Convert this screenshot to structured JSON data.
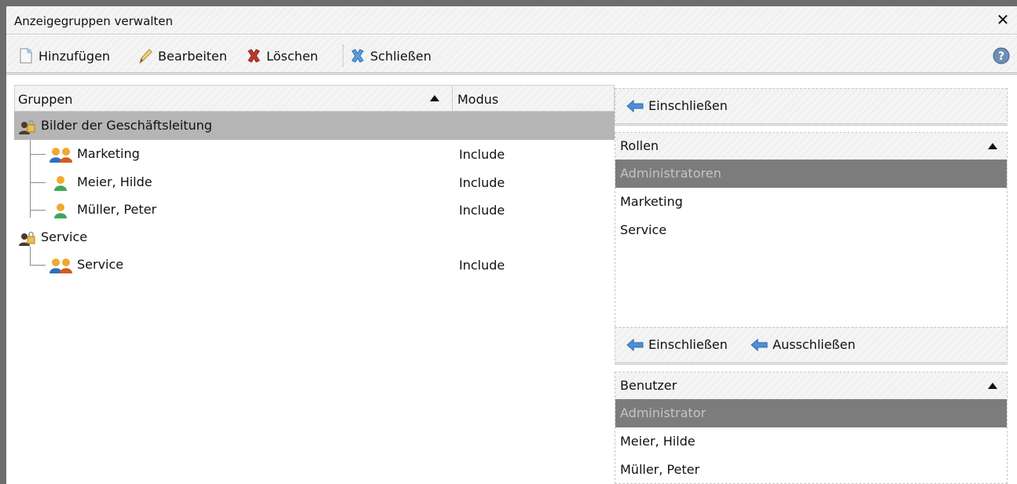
{
  "window": {
    "title": "Anzeigegruppen verwalten"
  },
  "toolbar": {
    "add_label": "Hinzufügen",
    "edit_label": "Bearbeiten",
    "delete_label": "Löschen",
    "close_label": "Schließen"
  },
  "tree": {
    "columns": {
      "groups": "Gruppen",
      "mode": "Modus"
    },
    "groups": [
      {
        "label": "Bilder der Geschäftsleitung",
        "selected": true,
        "children": [
          {
            "label": "Marketing",
            "mode": "Include",
            "type": "role"
          },
          {
            "label": "Meier, Hilde",
            "mode": "Include",
            "type": "user"
          },
          {
            "label": "Müller, Peter",
            "mode": "Include",
            "type": "user"
          }
        ]
      },
      {
        "label": "Service",
        "selected": false,
        "children": [
          {
            "label": "Service",
            "mode": "Include",
            "type": "role"
          }
        ]
      }
    ]
  },
  "roles_panel": {
    "include_label": "Einschließen",
    "header": "Rollen",
    "items": [
      "Administratoren",
      "Marketing",
      "Service"
    ],
    "selected_item": "Administratoren"
  },
  "users_panel": {
    "include_label": "Einschließen",
    "exclude_label": "Ausschließen",
    "header": "Benutzer",
    "items": [
      "Administrator",
      "Meier, Hilde",
      "Müller, Peter"
    ],
    "selected_item": "Administrator"
  },
  "colors": {
    "selected_tree_row": "#b5b5b5",
    "selected_list_row": "#7c7c7c",
    "arrow_blue": "#4a90d9",
    "delete_red": "#c0392b"
  }
}
